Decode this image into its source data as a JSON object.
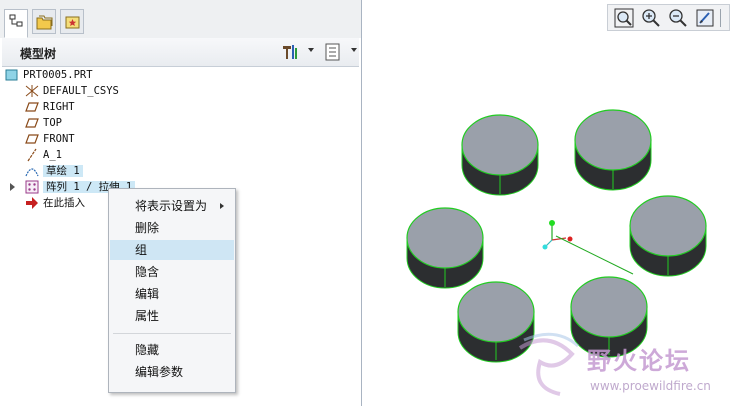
{
  "panel": {
    "title": "模型树"
  },
  "tree": {
    "items": [
      {
        "label": "PRT0005.PRT",
        "icon": "part-icon"
      },
      {
        "label": "DEFAULT_CSYS",
        "icon": "csys-icon"
      },
      {
        "label": "RIGHT",
        "icon": "datum-plane-icon"
      },
      {
        "label": "TOP",
        "icon": "datum-plane-icon"
      },
      {
        "label": "FRONT",
        "icon": "datum-plane-icon"
      },
      {
        "label": "A_1",
        "icon": "datum-axis-icon"
      },
      {
        "label": "草绘 1",
        "icon": "sketch-icon"
      },
      {
        "label": "阵列 1 / 拉伸 1",
        "icon": "pattern-icon"
      },
      {
        "label": "在此插入",
        "icon": "insert-arrow-icon"
      }
    ]
  },
  "menu": {
    "items": [
      {
        "label": "将表示设置为",
        "submenu": true
      },
      {
        "label": "删除"
      },
      {
        "label": "组"
      },
      {
        "label": "隐含"
      },
      {
        "label": "编辑"
      },
      {
        "label": "属性"
      },
      {
        "label": "隐藏"
      },
      {
        "label": "编辑参数"
      }
    ],
    "selected": "组"
  },
  "watermark": {
    "title": "野火论坛",
    "url": "www.proewildfire.cn"
  },
  "colors": {
    "selection": "#cde8f6",
    "edge_green": "#22cc22",
    "cylinder_top": "#9aa0aa",
    "cylinder_side": "#2c2e30",
    "watermark": "#c59bd2"
  }
}
